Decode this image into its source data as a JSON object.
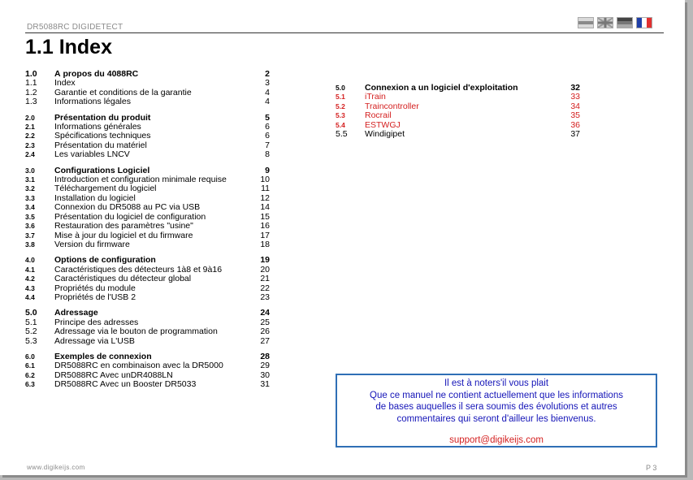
{
  "header": {
    "brand": "DR5088RC DIGIDETECT"
  },
  "title": "1.1 Index",
  "flags": [
    {
      "name": "dutch-flag-icon",
      "class": "flag-nl"
    },
    {
      "name": "uk-flag-icon",
      "class": "flag-uk"
    },
    {
      "name": "german-flag-icon",
      "class": "flag-de"
    },
    {
      "name": "french-flag-icon",
      "class": "flag-fr"
    }
  ],
  "toc_left": [
    [
      {
        "num": "1.0",
        "label": "À propos du 4088RC",
        "page": "2",
        "head": true
      },
      {
        "num": "1.1",
        "label": "Index",
        "page": "3"
      },
      {
        "num": "1.2",
        "label": "Garantie et conditions de la garantie",
        "page": "4"
      },
      {
        "num": "1.3",
        "label": "Informations légales",
        "page": "4"
      }
    ],
    [
      {
        "num": "2.0",
        "label": "Présentation du produit",
        "page": "5",
        "head": true,
        "tight": true
      },
      {
        "num": "2.1",
        "label": "Informations générales",
        "page": "6",
        "tight": true
      },
      {
        "num": "2.2",
        "label": "Spécifications techniques",
        "page": "6",
        "tight": true
      },
      {
        "num": "2.3",
        "label": "Présentation du matériel",
        "page": "7",
        "tight": true
      },
      {
        "num": "2.4",
        "label": "Les variables LNCV",
        "page": "8",
        "tight": true
      }
    ],
    [
      {
        "num": "3.0",
        "label": "Configurations Logiciel",
        "page": "9",
        "head": true,
        "tight": true
      },
      {
        "num": "3.1",
        "label": "Introduction et configuration minimale requise",
        "page": "10",
        "tight": true
      },
      {
        "num": "3.2",
        "label": "Téléchargement du logiciel",
        "page": "11",
        "tight": true
      },
      {
        "num": "3.3",
        "label": "Installation du logiciel",
        "page": "12",
        "tight": true
      },
      {
        "num": "3.4",
        "label": "Connexion du DR5088 au PC via USB",
        "page": "14",
        "tight": true
      },
      {
        "num": "3.5",
        "label": "Présentation du logiciel de configuration",
        "page": "15",
        "tight": true
      },
      {
        "num": "3.6",
        "label": "Restauration des paramètres \"usine\"",
        "page": "16",
        "tight": true
      },
      {
        "num": "3.7",
        "label": "Mise à jour du logiciel et du firmware",
        "page": "17",
        "tight": true
      },
      {
        "num": "3.8",
        "label": "Version du firmware",
        "page": "18",
        "tight": true
      }
    ],
    [
      {
        "num": "4.0",
        "label": "Options de configuration",
        "page": "19",
        "head": true,
        "tight": true
      },
      {
        "num": "4.1",
        "label": "Caractéristiques des détecteurs 1à8 et 9à16",
        "page": "20",
        "tight": true
      },
      {
        "num": "4.2",
        "label": "Caractéristiques du détecteur global",
        "page": "21",
        "tight": true
      },
      {
        "num": "4.3",
        "label": "Propriétés du module",
        "page": "22",
        "tight": true
      },
      {
        "num": "4.4",
        "label": "Propriétés de l'USB 2",
        "page": "23",
        "tight": true
      }
    ],
    [
      {
        "num": "5.0",
        "label": "Adressage",
        "page": "24",
        "head": true
      },
      {
        "num": "5.1",
        "label": "Principe des adresses",
        "page": "25"
      },
      {
        "num": "5.2",
        "label": "Adressage via le bouton de programmation",
        "page": "26"
      },
      {
        "num": "5.3",
        "label": "Adressage via L'USB",
        "page": "27"
      }
    ],
    [
      {
        "num": "6.0",
        "label": "Exemples de connexion",
        "page": "28",
        "head": true,
        "tight": true
      },
      {
        "num": "6.1",
        "label": "DR5088RC en combinaison avec la DR5000",
        "page": "29",
        "tight": true
      },
      {
        "num": "6.2",
        "label": "DR5088RC Avec unDR4088LN",
        "page": "30",
        "tight": true
      },
      {
        "num": "6.3",
        "label": "DR5088RC Avec un Booster DR5033",
        "page": "31",
        "tight": true
      }
    ]
  ],
  "toc_right": [
    {
      "num": "5.0",
      "label": "Connexion a un logiciel d'exploitation",
      "page": "32",
      "head": true,
      "tight": true
    },
    {
      "num": "5.1",
      "label": "iTrain",
      "page": "33",
      "red": true,
      "tight": true
    },
    {
      "num": "5.2",
      "label": "Traincontroller",
      "page": "34",
      "red": true,
      "tight": true
    },
    {
      "num": "5.3",
      "label": "Rocrail",
      "page": "35",
      "red": true,
      "tight": true
    },
    {
      "num": "5.4",
      "label": "ESTWGJ",
      "page": "36",
      "red": true,
      "tight": true
    },
    {
      "num": "5.5",
      "label": "Windigipet",
      "page": "37"
    }
  ],
  "notice": {
    "line1": "Il est à noters'il vous plait",
    "line2": "Que ce manuel ne contient actuellement que les informations",
    "line3": "de bases auquelles il sera soumis des évolutions et autres",
    "line4": "commentaires qui seront d'ailleur les bienvenus.",
    "email": "support@digikeijs.com"
  },
  "footer": {
    "website": "www.digikeijs.com",
    "page": "P 3"
  }
}
